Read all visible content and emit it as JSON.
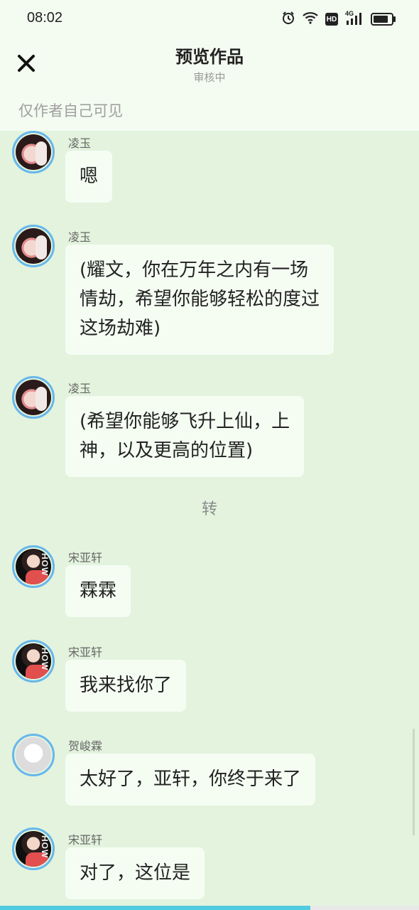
{
  "status_bar": {
    "time": "08:02",
    "hd_label": "HD",
    "network_label": "4G",
    "icons": [
      "alarm-icon",
      "wifi-icon",
      "hd-icon",
      "signal-4g-icon",
      "battery-icon"
    ]
  },
  "header": {
    "close_icon": "close-icon",
    "title": "预览作品",
    "subtitle": "审核中",
    "visibility_note": "仅作者自己可见"
  },
  "messages": [
    {
      "speaker": "凌玉",
      "text_lines": [
        "嗯"
      ]
    },
    {
      "speaker": "凌玉",
      "text_lines": [
        "(耀文，你在万年之内有一场",
        "情劫，希望你能够轻松的度过",
        "这场劫难)"
      ]
    },
    {
      "speaker": "凌玉",
      "text_lines": [
        "(希望你能够飞升上仙，上",
        "神，以及更高的位置)"
      ]
    },
    {
      "speaker": "宋亚轩",
      "text_lines": [
        "霖霖"
      ]
    },
    {
      "speaker": "宋亚轩",
      "text_lines": [
        "我来找你了"
      ]
    },
    {
      "speaker": "贺峻霖",
      "text_lines": [
        "太好了，亚轩，你终于来了"
      ]
    },
    {
      "speaker": "宋亚轩",
      "text_lines": [
        "对了，这位是"
      ]
    }
  ],
  "scene_divider": "转",
  "reading_progress": 0.74,
  "colors": {
    "background": "#e3f3de",
    "header_bg": "#f4fbf1",
    "bubble": "#f5fdf3",
    "avatar_ring": "#66b7ea",
    "progress": "#50cbe0"
  }
}
